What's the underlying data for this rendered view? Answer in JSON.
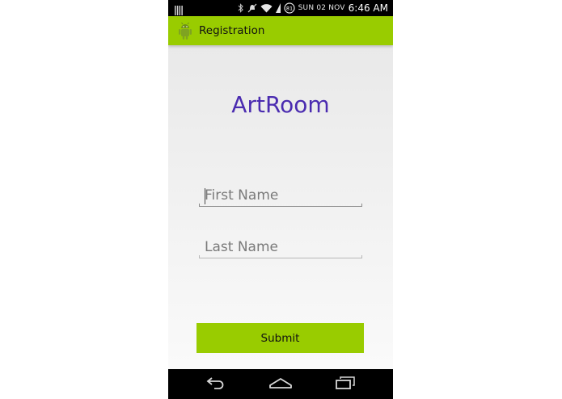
{
  "status_bar": {
    "date": "SUN 02 NOV",
    "time": "6:46 AM",
    "battery_level": "81"
  },
  "action_bar": {
    "title": "Registration",
    "icon": "android-icon"
  },
  "main": {
    "brand_title": "ArtRoom",
    "first_name": {
      "value": "",
      "placeholder": "First Name"
    },
    "last_name": {
      "value": "",
      "placeholder": "Last Name"
    },
    "submit_label": "Submit"
  },
  "nav_bar": {
    "icons": [
      "back-icon",
      "home-icon",
      "recent-apps-icon"
    ]
  },
  "colors": {
    "accent": "#99cc00",
    "title": "#4a2bb0",
    "background": "#f2f2f2"
  }
}
